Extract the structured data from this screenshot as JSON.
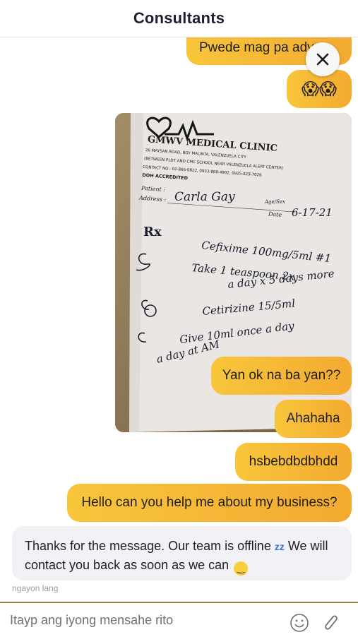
{
  "header": {
    "title": "Consultants"
  },
  "messages": {
    "m1": "Pwede mag pa adv",
    "m2": "😱😱",
    "m3": "Yan ok na ba yan??",
    "m4": "Ahahaha",
    "m5": "hsbebdbdbhdd",
    "m6": "Hello can you help me about my business?"
  },
  "photo": {
    "clinic_name": "GMWV MEDICAL CLINIC",
    "address_line": "26 MAYSAN ROAD, BGY MALINTA, VALENZUELA CITY",
    "between_line": "(BETWEEN PLDT AND CMC SCHOOL NEAR VALENZUELA ALERT CENTER)",
    "contact_line": "CONTACT NO.: 02-866-0822, 0933-868-4902, 0925-829-7026",
    "doh_line": "DOH ACCREDITED",
    "patient_label": "Patient :",
    "patient_value": "Carla Gay",
    "address_label": "Address :",
    "agesex_label": "Age/Sex",
    "date_label": "Date",
    "date_value": "6-17-21",
    "rx": "Rx",
    "line1": "Cefixime 100mg/5ml #1",
    "line2": "Take 1 teaspoon 2x",
    "line3": "a day x 5 days more",
    "line4": "Cetirizine 15/5ml",
    "line5": "Give 10ml once a day",
    "line6": "a day at AM"
  },
  "reply": {
    "text_part1": "Thanks for the message. Our team is offline",
    "text_part2": "We will contact you back as soon as we can",
    "zz_icon": "zz",
    "timestamp": "ngayon lang"
  },
  "composer": {
    "placeholder": "Itayp ang iyong mensahe rito"
  },
  "icons": {
    "close": "close-icon",
    "emoji": "smiley-icon",
    "attach": "paperclip-icon"
  },
  "colors": {
    "bubble_start": "#f8c63b",
    "bubble_end": "#f3aa30",
    "reply_bg": "#f1f1f6",
    "composer_border": "#9a8550"
  }
}
